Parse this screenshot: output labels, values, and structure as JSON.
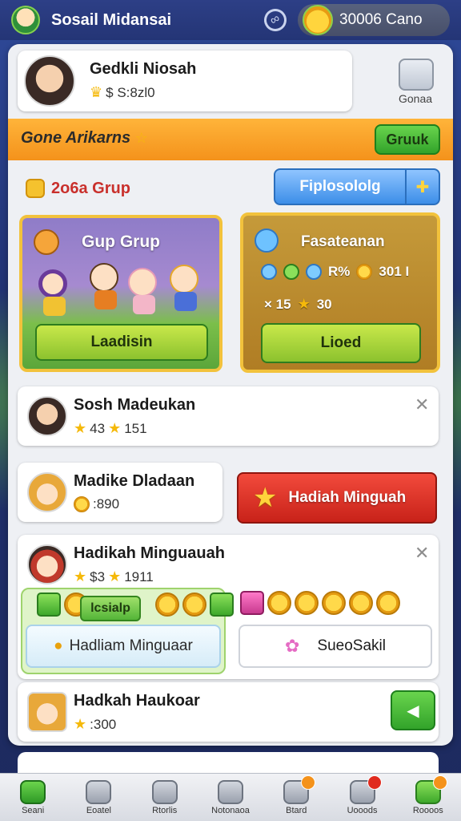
{
  "topbar": {
    "title": "Sosail Midansai",
    "coins": "30006 Cano"
  },
  "profile": {
    "name": "Gedkli Niosah",
    "stat": "$ S:8zl0",
    "game_label": "Gonaa"
  },
  "banner": {
    "title": "Gone Arikarns",
    "button": "Gruuk"
  },
  "groups": {
    "section_label": "2o6a Grup",
    "filter_button": "Fiplosololg",
    "left_card": {
      "title": "Gup Grup",
      "button": "Laadisin"
    },
    "right_card": {
      "title": "Fasateanan",
      "stat1": "R%",
      "stat1_value": "301 I",
      "stat2": "× 15",
      "stat2_value": "30",
      "button": "Lioed"
    }
  },
  "list": [
    {
      "name": "Sosh Madeukan",
      "stat_a": "43",
      "stat_b": "151"
    },
    {
      "name": "Madike Dladaan",
      "stat": ":890"
    },
    {
      "name": "Hadikah Minguauah",
      "stat_a": "$3",
      "stat_b": "1911",
      "tag": "lcsialp"
    },
    {
      "name": "Hadkah Haukoar",
      "stat": ":300"
    }
  ],
  "red_button": "Hadiah Minguah",
  "soft_buttons": {
    "left": "Hadliam Minguaar",
    "right": "SueoSakil"
  },
  "nav": [
    {
      "label": "Seani",
      "active": true
    },
    {
      "label": "Eoatel"
    },
    {
      "label": "Rtorlis"
    },
    {
      "label": "Notonaoa"
    },
    {
      "label": "Btard",
      "badge": ""
    },
    {
      "label": "Uooods",
      "badge": ""
    },
    {
      "label": "Roooos",
      "badge": ""
    }
  ],
  "colors": {
    "accent": "#f4921b",
    "primary_green": "#32a32a",
    "danger": "#c82219",
    "blue": "#3c8ee8"
  }
}
